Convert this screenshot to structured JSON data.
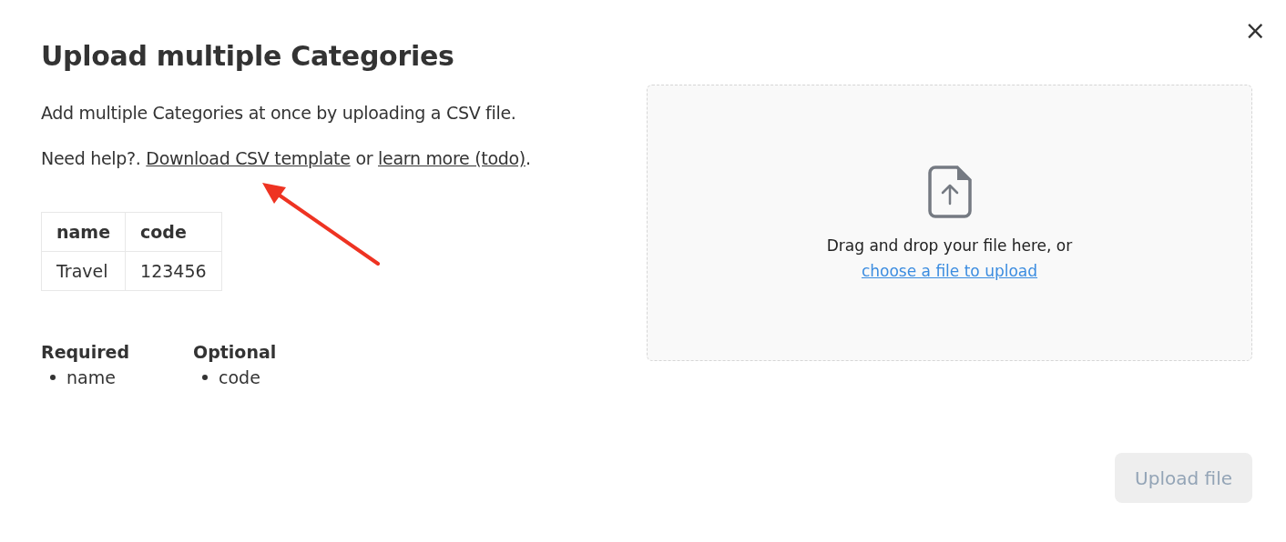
{
  "dialog": {
    "title": "Upload multiple Categories",
    "close": "×"
  },
  "intro": "Add multiple Categories at once by uploading a CSV file.",
  "help": {
    "prefix": "Need help?.",
    "download_link": "Download CSV template",
    "connector": "or",
    "learn_link": "learn more (todo)",
    "suffix": "."
  },
  "example_table": {
    "columns": [
      "name",
      "code"
    ],
    "rows": [
      [
        "Travel",
        "123456"
      ]
    ]
  },
  "fields": [
    {
      "heading": "Required",
      "items": [
        "name"
      ]
    },
    {
      "heading": "Optional",
      "items": [
        "code"
      ]
    }
  ],
  "dropzone": {
    "text": "Drag and drop your file here, or",
    "link": "choose a file to upload"
  },
  "upload_button": {
    "label": "Upload file",
    "disabled": true
  }
}
